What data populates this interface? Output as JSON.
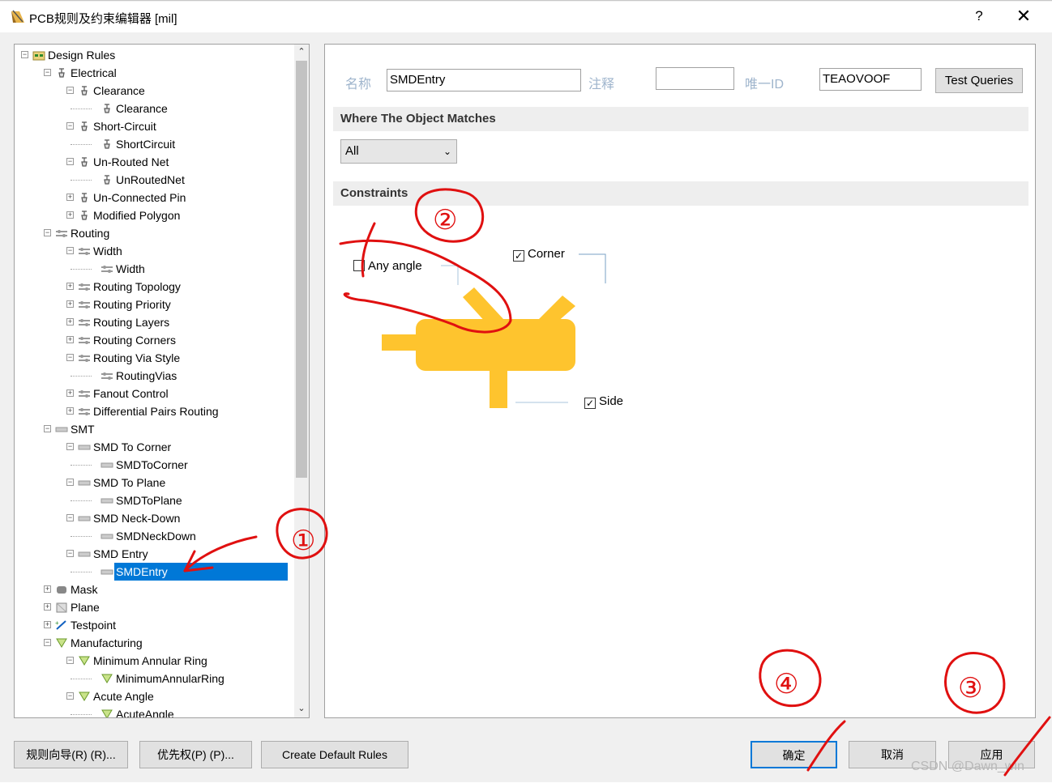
{
  "window": {
    "title": "PCB规则及约束编辑器 [mil]",
    "help": "?",
    "close": "✕"
  },
  "tree": {
    "nodes": [
      {
        "label": "Design Rules"
      },
      {
        "label": "Electrical"
      },
      {
        "label": "Clearance"
      },
      {
        "label": "Clearance"
      },
      {
        "label": "Short-Circuit"
      },
      {
        "label": "ShortCircuit"
      },
      {
        "label": "Un-Routed Net"
      },
      {
        "label": "UnRoutedNet"
      },
      {
        "label": "Un-Connected Pin"
      },
      {
        "label": "Modified Polygon"
      },
      {
        "label": "Routing"
      },
      {
        "label": "Width"
      },
      {
        "label": "Width"
      },
      {
        "label": "Routing Topology"
      },
      {
        "label": "Routing Priority"
      },
      {
        "label": "Routing Layers"
      },
      {
        "label": "Routing Corners"
      },
      {
        "label": "Routing Via Style"
      },
      {
        "label": "RoutingVias"
      },
      {
        "label": "Fanout Control"
      },
      {
        "label": "Differential Pairs Routing"
      },
      {
        "label": "SMT"
      },
      {
        "label": "SMD To Corner"
      },
      {
        "label": "SMDToCorner"
      },
      {
        "label": "SMD To Plane"
      },
      {
        "label": "SMDToPlane"
      },
      {
        "label": "SMD Neck-Down"
      },
      {
        "label": "SMDNeckDown"
      },
      {
        "label": "SMD Entry"
      },
      {
        "label": "SMDEntry"
      },
      {
        "label": "Mask"
      },
      {
        "label": "Plane"
      },
      {
        "label": "Testpoint"
      },
      {
        "label": "Manufacturing"
      },
      {
        "label": "Minimum Annular Ring"
      },
      {
        "label": "MinimumAnnularRing"
      },
      {
        "label": "Acute Angle"
      },
      {
        "label": "AcuteAngle"
      }
    ],
    "selected": "SMDEntry"
  },
  "rule": {
    "name_label": "名称",
    "name_value": "SMDEntry",
    "comment_label": "注释",
    "comment_value": "",
    "uid_label": "唯一ID",
    "uid_value": "TEAOVOOF",
    "test_queries": "Test Queries"
  },
  "where": {
    "header": "Where The Object Matches",
    "selected": "All"
  },
  "constraints": {
    "header": "Constraints",
    "any_angle": {
      "label": "Any angle",
      "checked": false
    },
    "corner": {
      "label": "Corner",
      "checked": true
    },
    "side": {
      "label": "Side",
      "checked": true
    }
  },
  "bottom": {
    "wizard": "规则向导(R) (R)...",
    "priority": "优先权(P) (P)...",
    "create_default": "Create Default Rules",
    "ok": "确定",
    "cancel": "取消",
    "apply": "应用"
  },
  "watermark": "CSDN @Dawn_win",
  "annotations": [
    "①",
    "②",
    "③",
    "④"
  ],
  "colors": {
    "selection": "#0078d7",
    "pad": "#fec42e",
    "annotation": "#e01010",
    "label": "#9eb4cc"
  }
}
